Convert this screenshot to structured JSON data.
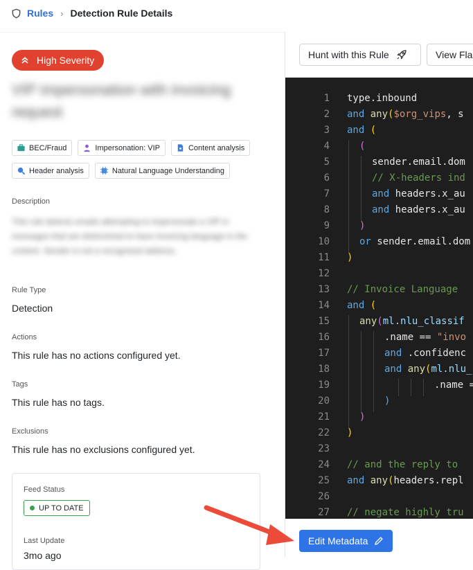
{
  "breadcrumb": {
    "root": "Rules",
    "current": "Detection Rule Details"
  },
  "severity": {
    "label": "High Severity",
    "color": "#e0422f"
  },
  "rule_title": "VIP impersonation with invoicing request",
  "tags": [
    {
      "label": "BEC/Fraud",
      "icon": "briefcase-icon"
    },
    {
      "label": "Impersonation: VIP",
      "icon": "person-icon"
    },
    {
      "label": "Content analysis",
      "icon": "document-icon"
    },
    {
      "label": "Header analysis",
      "icon": "magnifier-icon"
    },
    {
      "label": "Natural Language Understanding",
      "icon": "chip-icon"
    }
  ],
  "description": {
    "label": "Description",
    "text": "This rule detects emails attempting to impersonate a VIP in messages that are determined to have invoicing language in the content. Sender is not a recognized address."
  },
  "rule_type": {
    "label": "Rule Type",
    "value": "Detection"
  },
  "actions": {
    "label": "Actions",
    "value": "This rule has no actions configured yet."
  },
  "rule_tags": {
    "label": "Tags",
    "value": "This rule has no tags."
  },
  "exclusions": {
    "label": "Exclusions",
    "value": "This rule has no exclusions configured yet."
  },
  "feed": {
    "status_label": "Feed Status",
    "status_value": "UP TO DATE",
    "status_color": "#3aa14a",
    "update_label": "Last Update",
    "update_value": "3mo ago"
  },
  "toolbar": {
    "hunt_label": "Hunt with this Rule",
    "view_label": "View Fla"
  },
  "edit_button": {
    "label": "Edit Metadata"
  },
  "code_lines": [
    "1",
    "2",
    "3",
    "4",
    "5",
    "6",
    "7",
    "8",
    "9",
    "10",
    "11",
    "12",
    "13",
    "14",
    "15",
    "16",
    "17",
    "18",
    "19",
    "20",
    "21",
    "22",
    "23",
    "24",
    "25",
    "26",
    "27"
  ],
  "code": {
    "l1": "type.inbound",
    "l2a": "and ",
    "l2b": "any",
    "l2c": "(",
    "l2d": "$org_vips",
    "l2e": ", s",
    "l3a": "and ",
    "l3b": "(",
    "l4": "(",
    "l5": "sender.email.dom",
    "l6": "// X-headers ind",
    "l7a": "and ",
    "l7b": "headers.x_au",
    "l8a": "and ",
    "l8b": "headers.x_au",
    "l9": ")",
    "l10a": "or ",
    "l10b": "sender.email.dom",
    "l11": ")",
    "l13": "// Invoice Language",
    "l14a": "and ",
    "l14b": "(",
    "l15a": "any",
    "l15b": "(",
    "l15c": "ml.nlu_classif",
    "l16a": ".name == ",
    "l16b": "\"invo",
    "l17a": "and ",
    "l17b": ".confidenc",
    "l18a": "and ",
    "l18b": "any",
    "l18c": "(",
    "l18d": "ml.nlu_",
    "l19": ".name =",
    "l20": ")",
    "l21": ")",
    "l22": ")",
    "l24": "// and the reply to",
    "l25a": "and ",
    "l25b": "any",
    "l25c": "(",
    "l25d": "headers.repl",
    "l27": "// negate highly tru"
  }
}
